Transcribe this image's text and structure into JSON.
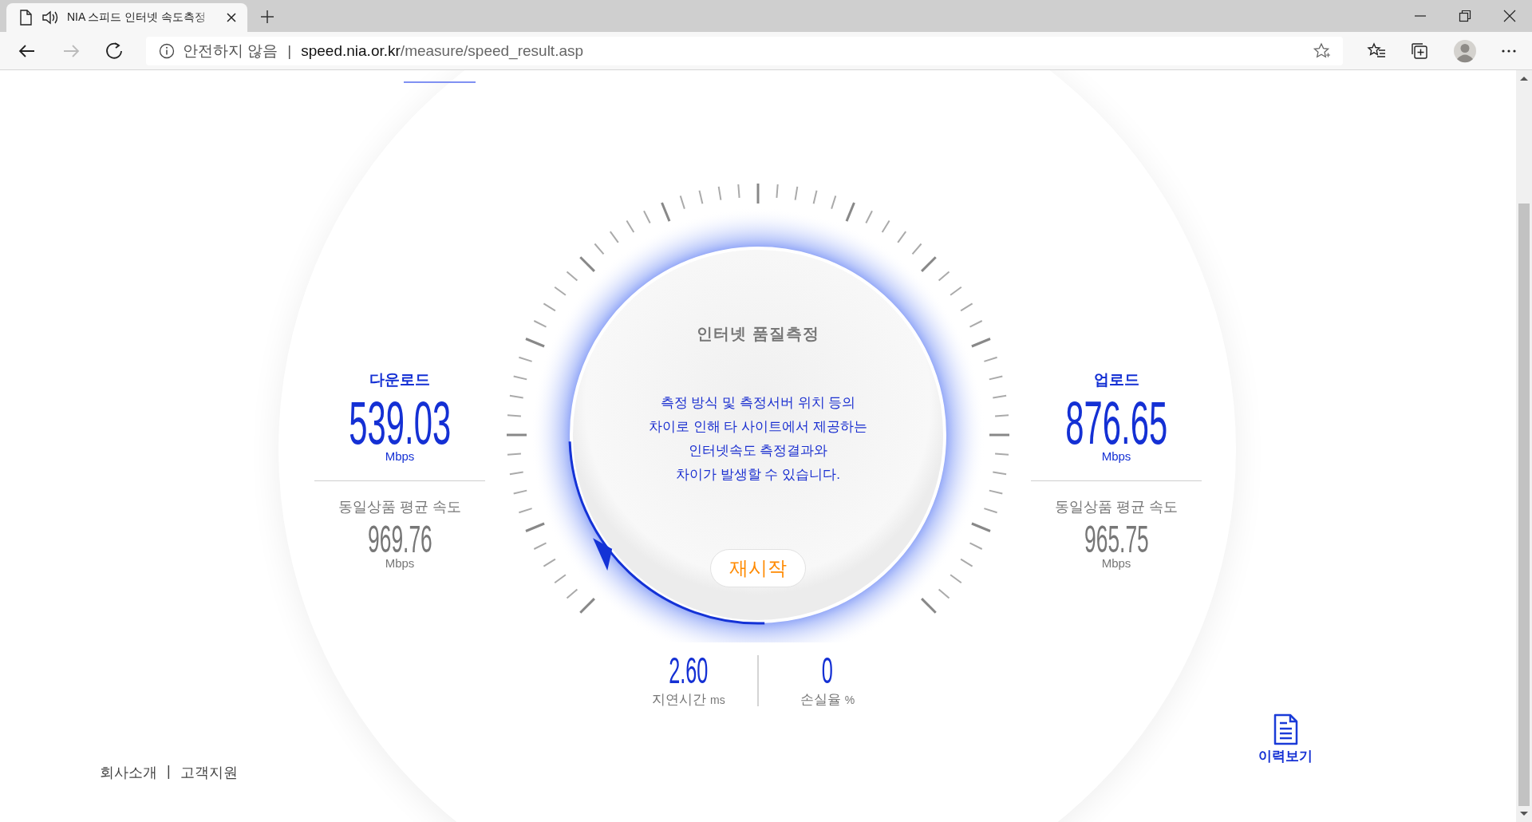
{
  "browser": {
    "tab_title": "NIA 스피드 인터넷 속도측정",
    "security_label": "안전하지 않음",
    "address_separator": "|",
    "url_host": "speed.nia.or.kr",
    "url_path": "/measure/speed_result.asp"
  },
  "panels": [
    {
      "label": "다운로드",
      "value": "539.03",
      "unit": "Mbps",
      "avg_label": "동일상품 평균 속도",
      "avg_value": "969.76",
      "avg_unit": "Mbps"
    },
    {
      "label": "업로드",
      "value": "876.65",
      "unit": "Mbps",
      "avg_label": "동일상품 평균 속도",
      "avg_value": "965.75",
      "avg_unit": "Mbps"
    }
  ],
  "dial": {
    "title": "인터넷 품질측정",
    "notice": [
      "측정 방식 및 측정서버 위치 등의",
      "차이로 인해 타 사이트에서 제공하는",
      "인터넷속도 측정결과와",
      "차이가 발생할 수 있습니다."
    ],
    "restart_button": "재시작"
  },
  "stats": [
    {
      "value": "2.60",
      "label": "지연시간",
      "unit": "ms"
    },
    {
      "value": "0",
      "label": "손실율",
      "unit": "%"
    }
  ],
  "footer": {
    "links": [
      "회사소개",
      "고객지원"
    ],
    "separator": "|"
  },
  "history_button": {
    "label": "이력보기"
  }
}
